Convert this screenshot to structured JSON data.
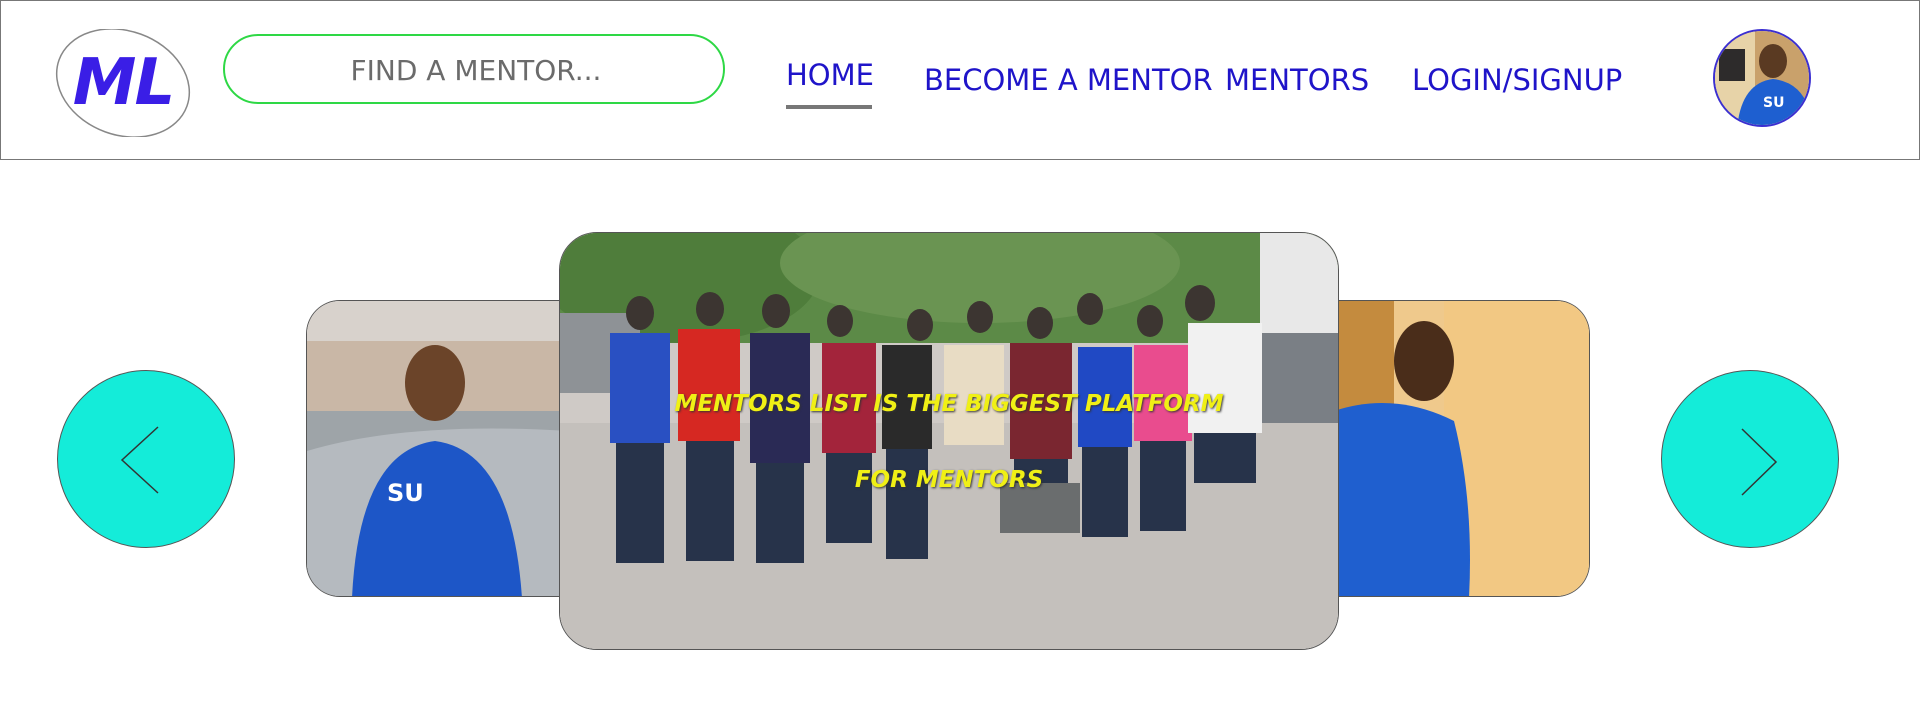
{
  "header": {
    "logo_text": "ML",
    "search": {
      "placeholder": "FIND A MENTOR..."
    },
    "nav": {
      "home": "HOME",
      "become_mentor": "BECOME A MENTOR",
      "mentors": "MENTORS",
      "login_signup": "LOGIN/SIGNUP"
    }
  },
  "carousel": {
    "caption_line1": "MENTORS LIST IS THE BIGGEST PLATFORM",
    "caption_line2": "FOR MENTORS",
    "prev_icon": "chevron-left-icon",
    "next_icon": "chevron-right-icon"
  },
  "colors": {
    "brand": "#3a1ee6",
    "nav_link": "#1f14c9",
    "search_border": "#2ed845",
    "arrow_bg": "#14ecd9",
    "caption": "#f0f015"
  }
}
